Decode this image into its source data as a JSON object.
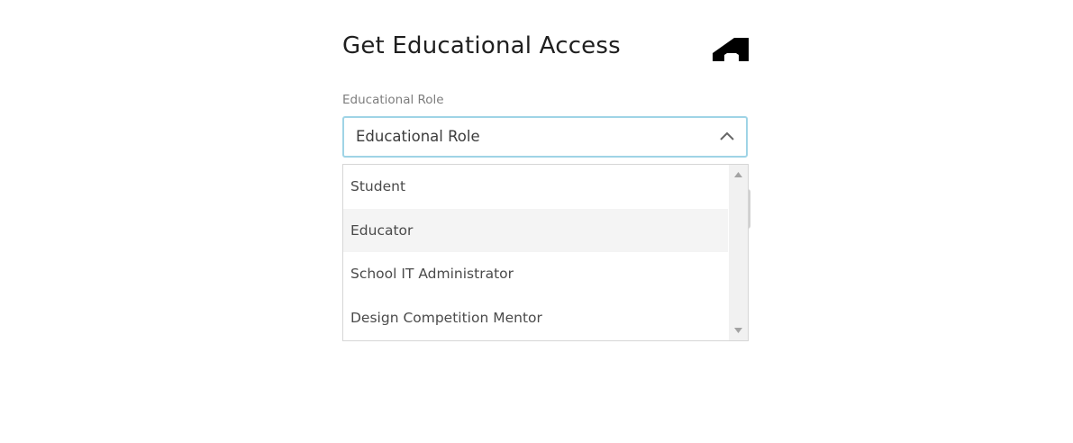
{
  "header": {
    "title": "Get Educational Access",
    "logo_icon": "autodesk-logo-icon"
  },
  "form": {
    "role_label": "Educational Role",
    "role_select": {
      "value": "Educational Role",
      "expanded": true,
      "border_color": "#9fd4e6",
      "chevron_icon": "chevron-up-icon"
    },
    "options": [
      {
        "label": "Student",
        "highlighted": false
      },
      {
        "label": "Educator",
        "highlighted": true
      },
      {
        "label": "School IT Administrator",
        "highlighted": false
      },
      {
        "label": "Design Competition Mentor",
        "highlighted": false
      }
    ]
  },
  "colors": {
    "highlight_bg": "#f4f4f4",
    "scrollbar_bg": "#f1f1f1",
    "text": "#4a4a4a"
  }
}
